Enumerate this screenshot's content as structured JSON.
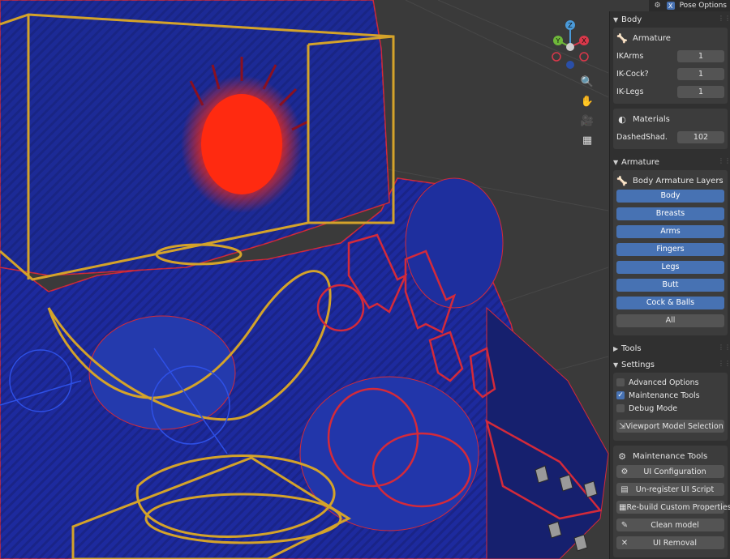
{
  "header": {
    "close_label": "X",
    "mode_label": "Pose Options"
  },
  "panel": {
    "body": {
      "title": "Body",
      "armature": {
        "title": "Armature",
        "props": [
          {
            "label": "IKArms",
            "value": "1"
          },
          {
            "label": "IK-Cock?",
            "value": "1"
          },
          {
            "label": "IK-Legs",
            "value": "1"
          }
        ]
      },
      "materials": {
        "title": "Materials",
        "props": [
          {
            "label": "DashedShad...",
            "value": "102"
          }
        ]
      }
    },
    "armature": {
      "title": "Armature",
      "layers": {
        "title": "Body Armature Layers",
        "buttons": [
          {
            "label": "Body",
            "active": true
          },
          {
            "label": "Breasts",
            "active": true
          },
          {
            "label": "Arms",
            "active": true
          },
          {
            "label": "Fingers",
            "active": true
          },
          {
            "label": "Legs",
            "active": true
          },
          {
            "label": "Butt",
            "active": true
          },
          {
            "label": "Cock & Balls",
            "active": true
          },
          {
            "label": "All",
            "active": false
          }
        ]
      }
    },
    "tools": {
      "title": "Tools"
    },
    "settings": {
      "title": "Settings",
      "checkboxes": [
        {
          "label": "Advanced Options",
          "checked": false
        },
        {
          "label": "Maintenance Tools",
          "checked": true
        },
        {
          "label": "Debug Mode",
          "checked": false
        }
      ],
      "viewport_button": "Viewport Model Selection",
      "maintenance": {
        "title": "Maintenance Tools",
        "buttons": [
          {
            "label": "UI Configuration",
            "icon": "gear-icon"
          },
          {
            "label": "Un-register UI Script",
            "icon": "document-icon"
          },
          {
            "label": "Re-build Custom Properties",
            "icon": "rebuild-icon"
          },
          {
            "label": "Clean model",
            "icon": "brush-icon"
          },
          {
            "label": "UI Removal",
            "icon": "x-icon"
          }
        ]
      }
    }
  },
  "gizmo": {
    "z": "Z",
    "y": "Y",
    "x": "X"
  },
  "colors": {
    "accent": "#4772b3",
    "panel_bg": "#303030",
    "box_bg": "#3c3c3c",
    "field_bg": "#545454",
    "viewport_bg": "#3a3a3a"
  }
}
